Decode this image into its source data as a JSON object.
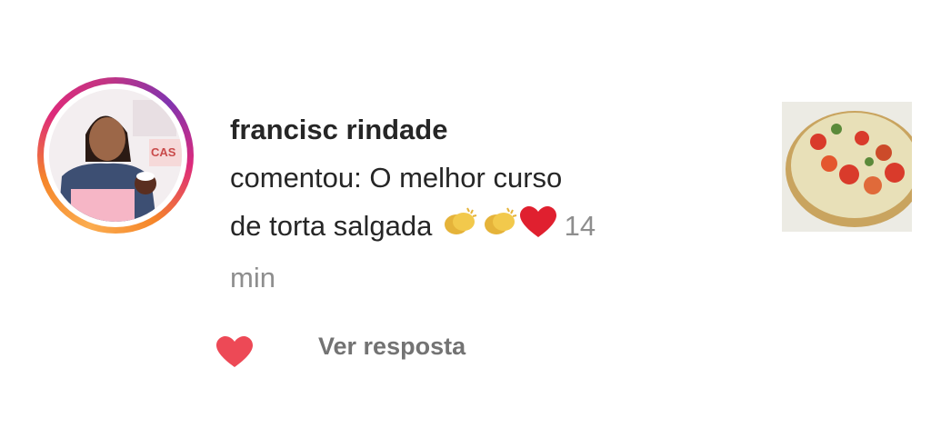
{
  "notification": {
    "username": "francisc     rindade",
    "comment_prefix": "comentou: O melhor curso",
    "comment_line2": "de torta salgada",
    "emojis": [
      "clapping-hands",
      "clapping-hands",
      "red-heart"
    ],
    "time_value": "14",
    "time_unit": "min"
  },
  "actions": {
    "reply_label": "Ver resposta"
  },
  "colors": {
    "heart": "#ed4956",
    "text": "#262626",
    "muted": "#8e8e8e"
  }
}
